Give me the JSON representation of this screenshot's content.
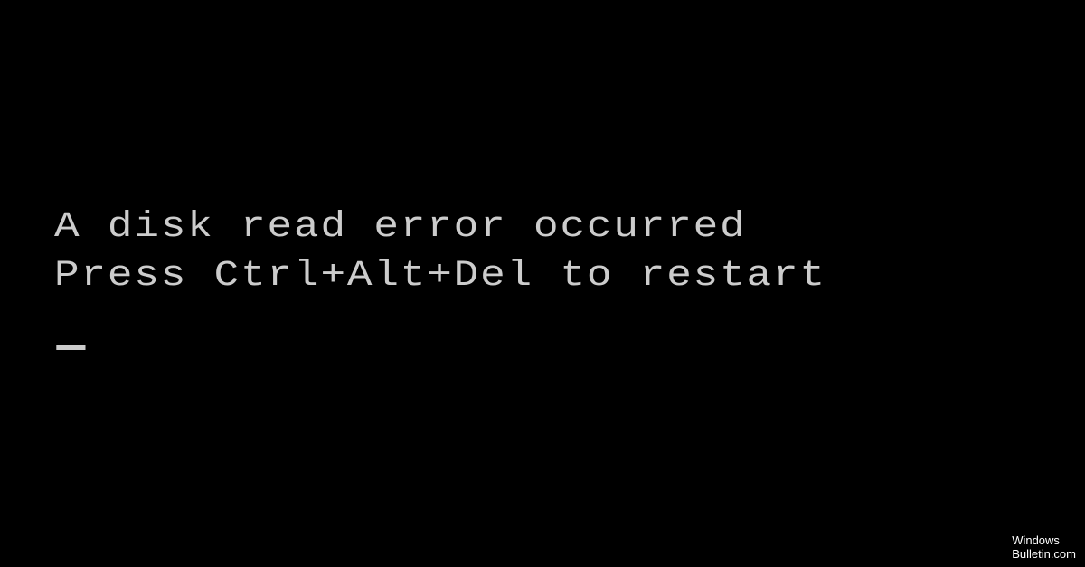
{
  "terminal": {
    "lines": [
      "A disk read error occurred",
      "Press Ctrl+Alt+Del to restart"
    ],
    "cursor": "_"
  },
  "watermark": {
    "line1": "Windows",
    "line2": "Bulletin.com"
  }
}
